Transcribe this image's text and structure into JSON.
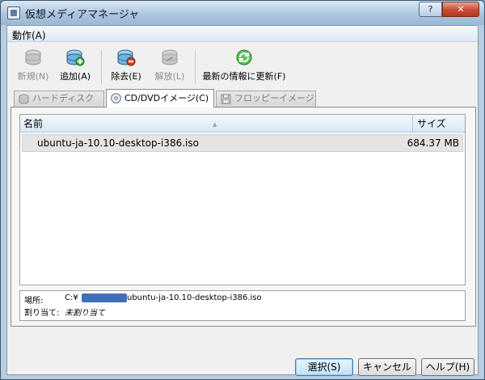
{
  "window": {
    "title": "仮想メディアマネージャ",
    "help_button": "?",
    "close_button": "✕"
  },
  "menu": {
    "action": "動作(A)"
  },
  "toolbar": {
    "new": "新規(N)",
    "add": "追加(A)",
    "remove": "除去(E)",
    "release": "解放(L)",
    "refresh": "最新の情報に更新(F)"
  },
  "tabs": {
    "hard_disk": "ハードディスク(D)",
    "cd_dvd": "CD/DVDイメージ(C)",
    "floppy": "フロッピーイメージ(F)"
  },
  "list": {
    "columns": {
      "name": "名前",
      "size": "サイズ"
    },
    "rows": [
      {
        "name": "ubuntu-ja-10.10-desktop-i386.iso",
        "size": "684.37 MB"
      }
    ]
  },
  "info": {
    "location_label": "場所:",
    "location_prefix": "C:¥",
    "location_suffix": "ubuntu-ja-10.10-desktop-i386.iso",
    "attached_label": "割り当て:",
    "attached_value": "未割り当て"
  },
  "buttons": {
    "select": "選択(S)",
    "cancel": "キャンセル",
    "help": "ヘルプ(H)"
  }
}
